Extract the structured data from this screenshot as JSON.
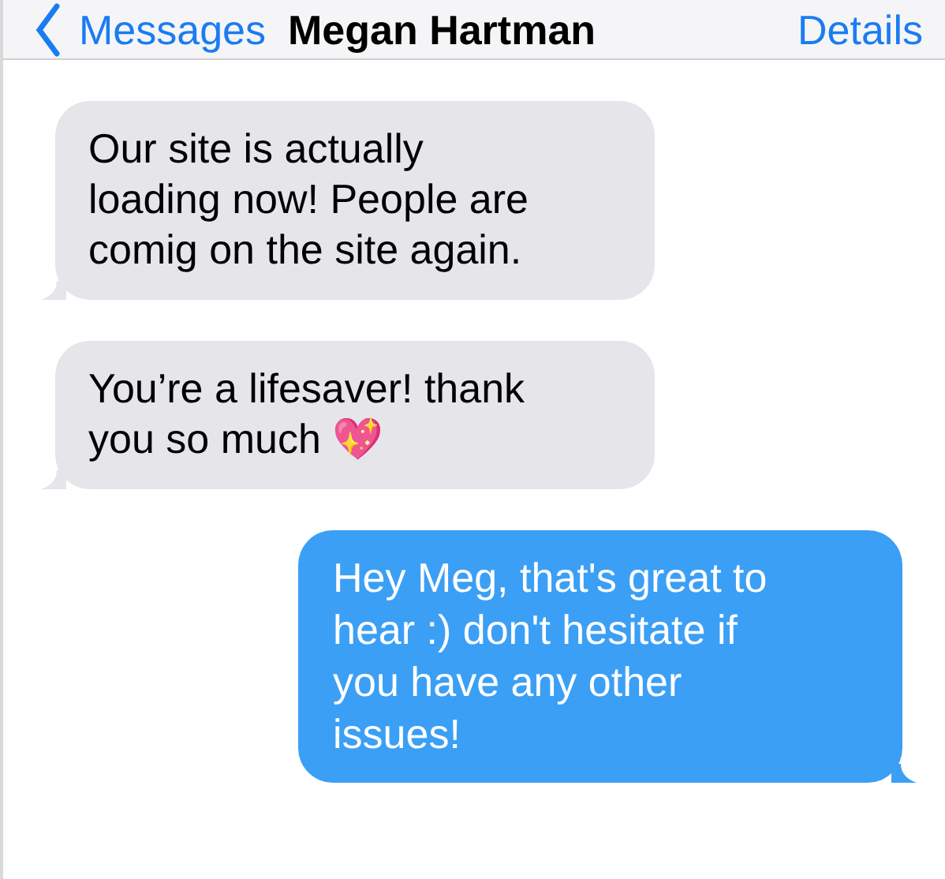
{
  "header": {
    "back_label": "Messages",
    "title": "Megan Hartman",
    "action": "Details"
  },
  "messages": [
    {
      "kind": "incoming",
      "text": "Our site is actually\nloading now! People are\ncomig on the site again."
    },
    {
      "kind": "incoming",
      "text": "You’re a lifesaver! thank\nyou so much 💖"
    },
    {
      "kind": "outgoing",
      "text": "Hey Meg, that's great to\nhear :) don't hesitate if\nyou have any other\nissues!"
    }
  ]
}
